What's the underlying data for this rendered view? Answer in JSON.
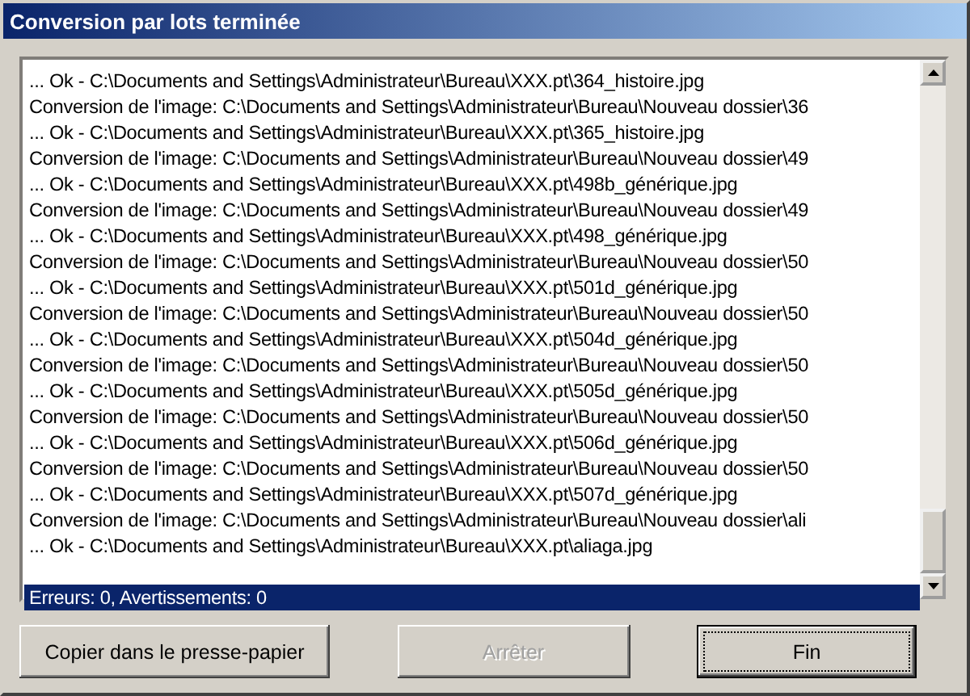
{
  "window": {
    "title": "Conversion par lots terminée"
  },
  "log": [
    {
      "text": "... Ok - C:\\Documents and Settings\\Administrateur\\Bureau\\XXX.pt\\364_histoire.jpg",
      "selected": false
    },
    {
      "text": "Conversion de l'image: C:\\Documents and Settings\\Administrateur\\Bureau\\Nouveau dossier\\36",
      "selected": false
    },
    {
      "text": "... Ok - C:\\Documents and Settings\\Administrateur\\Bureau\\XXX.pt\\365_histoire.jpg",
      "selected": false
    },
    {
      "text": "Conversion de l'image: C:\\Documents and Settings\\Administrateur\\Bureau\\Nouveau dossier\\49",
      "selected": false
    },
    {
      "text": "... Ok - C:\\Documents and Settings\\Administrateur\\Bureau\\XXX.pt\\498b_générique.jpg",
      "selected": false
    },
    {
      "text": "Conversion de l'image: C:\\Documents and Settings\\Administrateur\\Bureau\\Nouveau dossier\\49",
      "selected": false
    },
    {
      "text": "... Ok - C:\\Documents and Settings\\Administrateur\\Bureau\\XXX.pt\\498_générique.jpg",
      "selected": false
    },
    {
      "text": "Conversion de l'image: C:\\Documents and Settings\\Administrateur\\Bureau\\Nouveau dossier\\50",
      "selected": false
    },
    {
      "text": "... Ok - C:\\Documents and Settings\\Administrateur\\Bureau\\XXX.pt\\501d_générique.jpg",
      "selected": false
    },
    {
      "text": "Conversion de l'image: C:\\Documents and Settings\\Administrateur\\Bureau\\Nouveau dossier\\50",
      "selected": false
    },
    {
      "text": "... Ok - C:\\Documents and Settings\\Administrateur\\Bureau\\XXX.pt\\504d_générique.jpg",
      "selected": false
    },
    {
      "text": "Conversion de l'image: C:\\Documents and Settings\\Administrateur\\Bureau\\Nouveau dossier\\50",
      "selected": false
    },
    {
      "text": "... Ok - C:\\Documents and Settings\\Administrateur\\Bureau\\XXX.pt\\505d_générique.jpg",
      "selected": false
    },
    {
      "text": "Conversion de l'image: C:\\Documents and Settings\\Administrateur\\Bureau\\Nouveau dossier\\50",
      "selected": false
    },
    {
      "text": "... Ok - C:\\Documents and Settings\\Administrateur\\Bureau\\XXX.pt\\506d_générique.jpg",
      "selected": false
    },
    {
      "text": "Conversion de l'image: C:\\Documents and Settings\\Administrateur\\Bureau\\Nouveau dossier\\50",
      "selected": false
    },
    {
      "text": "... Ok - C:\\Documents and Settings\\Administrateur\\Bureau\\XXX.pt\\507d_générique.jpg",
      "selected": false
    },
    {
      "text": "Conversion de l'image: C:\\Documents and Settings\\Administrateur\\Bureau\\Nouveau dossier\\ali",
      "selected": false
    },
    {
      "text": "... Ok - C:\\Documents and Settings\\Administrateur\\Bureau\\XXX.pt\\aliaga.jpg",
      "selected": false
    },
    {
      "text": "Erreurs: 0, Avertissements: 0",
      "selected": true
    }
  ],
  "buttons": [
    {
      "label": "Copier dans le presse-papier",
      "disabled": false,
      "default": false
    },
    {
      "label": "Arrêter",
      "disabled": true,
      "default": false
    },
    {
      "label": "Fin",
      "disabled": false,
      "default": true
    }
  ]
}
